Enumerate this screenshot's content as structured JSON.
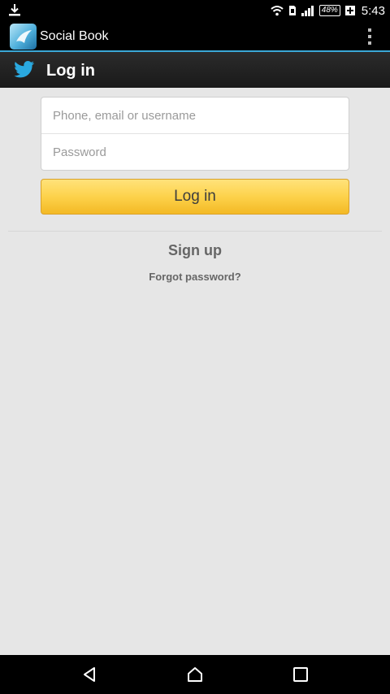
{
  "status_bar": {
    "battery": "48%",
    "time": "5:43"
  },
  "action_bar": {
    "app_title": "Social Book"
  },
  "login_header": {
    "title": "Log in"
  },
  "form": {
    "username_placeholder": "Phone, email or username",
    "username_value": "",
    "password_placeholder": "Password",
    "password_value": "",
    "login_button": "Log in"
  },
  "links": {
    "sign_up": "Sign up",
    "forgot_password": "Forgot password?"
  },
  "colors": {
    "accent": "#3aa7d6",
    "twitter_blue": "#2aa9e0",
    "button_yellow": "#fdd24b"
  }
}
